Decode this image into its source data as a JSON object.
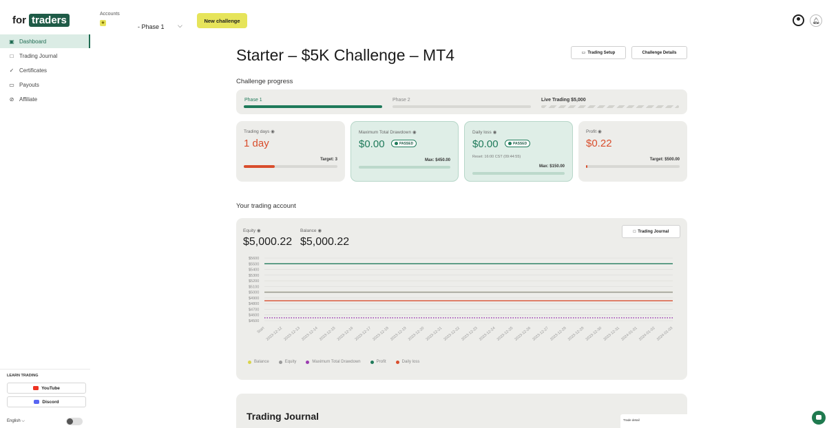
{
  "header": {
    "logo_for": "for",
    "logo_brand": "traders",
    "accounts_label": "Accounts",
    "account_phase": "- Phase 1",
    "new_challenge": "New challenge"
  },
  "sidebar": {
    "items": [
      {
        "label": "Dashboard",
        "icon": "dashboard-icon"
      },
      {
        "label": "Trading Journal",
        "icon": "book-icon"
      },
      {
        "label": "Certificates",
        "icon": "certificate-icon"
      },
      {
        "label": "Payouts",
        "icon": "payout-icon"
      },
      {
        "label": "Affiliate",
        "icon": "link-icon"
      }
    ],
    "learn_label": "LEARN TRADING",
    "youtube": "YouTube",
    "discord": "Discord",
    "language": "English"
  },
  "main": {
    "title": "Starter – $5K Challenge – MT4",
    "trading_setup": "Trading Setup",
    "challenge_details": "Challenge Details",
    "progress_title": "Challenge progress",
    "phases": [
      {
        "label": "Phase 1",
        "status": "active"
      },
      {
        "label": "Phase 2",
        "status": "pending"
      },
      {
        "label": "Live Trading  $5,000",
        "status": "locked"
      }
    ],
    "cards": {
      "trading_days": {
        "label": "Trading days",
        "value": "1 day",
        "target": "Target: 3",
        "progress": 0.333
      },
      "max_drawdown": {
        "label": "Maximum Total Drawdown",
        "value": "$0.00",
        "badge": "PASSED",
        "max": "Max: $450.00",
        "progress": 0
      },
      "daily_loss": {
        "label": "Daily loss",
        "value": "$0.00",
        "badge": "PASSED",
        "reset": "Reset: 16:00 CST (09:44:55)",
        "max": "Max: $150.00",
        "progress": 0
      },
      "profit": {
        "label": "Profit",
        "value": "$0.22",
        "target": "Target: $500.00",
        "progress": 0.0004
      }
    },
    "account_title": "Your trading account",
    "equity_label": "Equity",
    "equity_value": "$5,000.22",
    "balance_label": "Balance",
    "balance_value": "$5,000.22",
    "trading_journal_btn": "Trading Journal",
    "journal_title": "Trading Journal",
    "trade_detail": "Trade detail"
  },
  "chart_data": {
    "type": "line",
    "x": [
      "Start",
      "2023-12-12",
      "2023-12-13",
      "2023-12-14",
      "2023-12-15",
      "2023-12-16",
      "2023-12-17",
      "2023-12-18",
      "2023-12-19",
      "2023-12-20",
      "2023-12-21",
      "2023-12-22",
      "2023-12-23",
      "2023-12-24",
      "2023-12-25",
      "2023-12-26",
      "2023-12-27",
      "2023-12-28",
      "2023-12-29",
      "2023-12-30",
      "2023-12-31",
      "2024-01-01",
      "2024-01-02",
      "2024-01-03"
    ],
    "ylim": [
      4500,
      5600
    ],
    "yticks": [
      "$5600",
      "$5500",
      "$5400",
      "$5300",
      "$5200",
      "$5100",
      "$5000",
      "$4900",
      "$4800",
      "$4700",
      "$4600",
      "$4500"
    ],
    "series": [
      {
        "name": "Balance",
        "color": "#d9d44a",
        "value": 5000,
        "style": "solid"
      },
      {
        "name": "Equity",
        "color": "#9a9a9a",
        "value": 5000,
        "style": "solid"
      },
      {
        "name": "Maximum Total Drawdown",
        "color": "#9b3bb0",
        "value": 4550,
        "style": "dotted"
      },
      {
        "name": "Profit",
        "color": "#1f7a5a",
        "value": 5500,
        "style": "solid"
      },
      {
        "name": "Daily loss",
        "color": "#d94d2c",
        "value": 4850,
        "style": "solid"
      }
    ]
  }
}
